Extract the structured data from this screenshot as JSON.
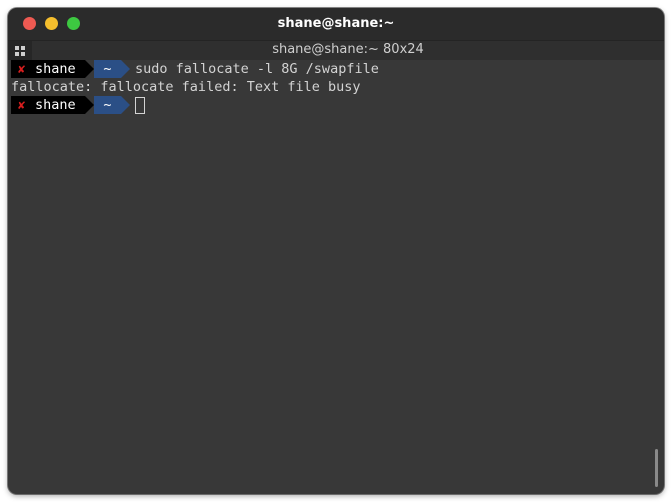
{
  "window": {
    "title": "shane@shane:~"
  },
  "tab": {
    "title": "shane@shane:~ 80x24"
  },
  "prompt": {
    "status_icon": "x-mark-icon",
    "user": "shane",
    "cwd": "~"
  },
  "terminal": {
    "command_1": "sudo fallocate -l 8G /swapfile",
    "output_1": "fallocate: fallocate failed: Text file busy"
  },
  "colors": {
    "background": "#383838",
    "titlebar": "#2b2b2b",
    "text": "#d3d3d3",
    "prompt_user_bg": "#000000",
    "prompt_dir_bg": "#2b4f86",
    "error_mark": "#d71e1e"
  }
}
